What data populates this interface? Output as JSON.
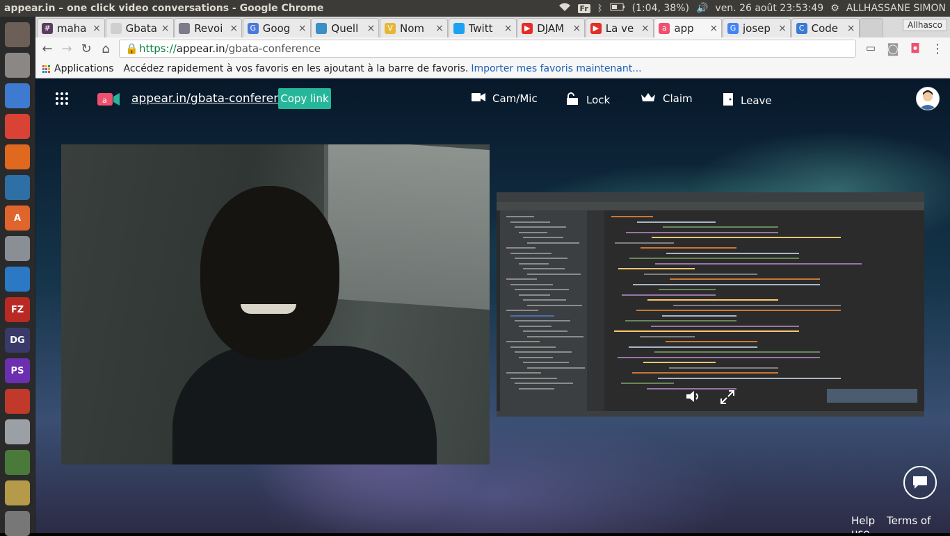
{
  "os": {
    "window_title": "appear.in – one click video conversations - Google Chrome",
    "keyboard_layout": "Fr",
    "battery": "(1:04, 38%)",
    "clock": "ven. 26 août 23:53:49",
    "user": "ALLHASSANE SIMON"
  },
  "launcher": {
    "items": [
      {
        "name": "ubuntu-dash-icon",
        "label": "",
        "color": "#6b5f58"
      },
      {
        "name": "files-icon",
        "label": "",
        "color": "#8a8784"
      },
      {
        "name": "chromium-icon",
        "label": "",
        "color": "#3f7ad1"
      },
      {
        "name": "chrome-icon",
        "label": "",
        "color": "#d94235"
      },
      {
        "name": "firefox-icon",
        "label": "",
        "color": "#e0681f"
      },
      {
        "name": "libreoffice-writer-icon",
        "label": "",
        "color": "#2e6fa5"
      },
      {
        "name": "software-center-icon",
        "label": "A",
        "color": "#e0652d"
      },
      {
        "name": "system-settings-icon",
        "label": "",
        "color": "#8a8f95"
      },
      {
        "name": "vscode-icon",
        "label": "",
        "color": "#2b78c5"
      },
      {
        "name": "filezilla-icon",
        "label": "FZ",
        "color": "#b92a24"
      },
      {
        "name": "datagrip-icon",
        "label": "DG",
        "color": "#3a3a6a"
      },
      {
        "name": "phpstorm-icon",
        "label": "PS",
        "color": "#6b2fb0"
      },
      {
        "name": "presentation-icon",
        "label": "",
        "color": "#c0392b"
      },
      {
        "name": "camera-icon",
        "label": "",
        "color": "#9aa0a6"
      },
      {
        "name": "pen-icon",
        "label": "",
        "color": "#4a7a3a"
      },
      {
        "name": "sound-icon",
        "label": "",
        "color": "#b59a4a"
      },
      {
        "name": "trash-icon",
        "label": "",
        "color": "#777"
      }
    ]
  },
  "chrome": {
    "tabs": [
      {
        "title": "maha",
        "fav_color": "#5a3c5e",
        "fav": "#"
      },
      {
        "title": "Gbata",
        "fav_color": "#cfcfcf",
        "fav": ""
      },
      {
        "title": "Revoi",
        "fav_color": "#7d7a8a",
        "fav": ""
      },
      {
        "title": "Goog",
        "fav_color": "#4b78d9",
        "fav": "G"
      },
      {
        "title": "Quell",
        "fav_color": "#3a8fc7",
        "fav": ""
      },
      {
        "title": "Nom",
        "fav_color": "#e6b737",
        "fav": "V"
      },
      {
        "title": "Twitt",
        "fav_color": "#1da1f2",
        "fav": ""
      },
      {
        "title": "DJAM",
        "fav_color": "#e52d27",
        "fav": "▶"
      },
      {
        "title": "La ve",
        "fav_color": "#e52d27",
        "fav": "▶"
      },
      {
        "title": "app",
        "fav_color": "#f0506e",
        "fav": "a",
        "active": true
      },
      {
        "title": "josep",
        "fav_color": "#4285f4",
        "fav": "G"
      },
      {
        "title": "Code",
        "fav_color": "#3a7bd5",
        "fav": "C"
      }
    ],
    "profile_badge": "Allhasco",
    "url_scheme": "https://",
    "url_host": "appear.in",
    "url_path": "/gbata-conference",
    "bookmarks_apps": "Applications",
    "bookmarks_hint": "Accédez rapidement à vos favoris en les ajoutant à la barre de favoris.",
    "bookmarks_import": "Importer mes favoris maintenant..."
  },
  "appear": {
    "room_url": "appear.in/gbata-conference",
    "copy_label": "Copy link",
    "cammic_label": "Cam/Mic",
    "lock_label": "Lock",
    "claim_label": "Claim",
    "leave_label": "Leave",
    "footer_help": "Help",
    "footer_terms": "Terms of use"
  }
}
